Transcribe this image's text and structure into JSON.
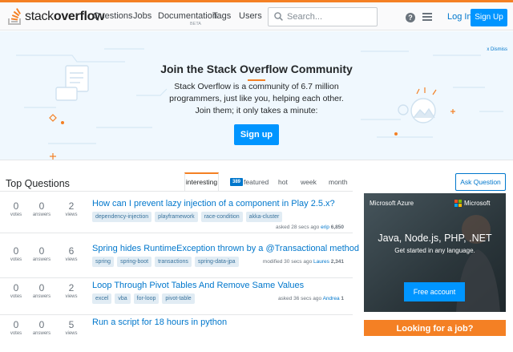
{
  "brand": {
    "logo_light": "stack",
    "logo_bold": "overflow",
    "accent": "#f48024",
    "link": "#0077cc",
    "primary": "#0095ff"
  },
  "nav": {
    "questions": "Questions",
    "jobs": "Jobs",
    "documentation": "Documentation",
    "documentation_badge": "BETA",
    "tags": "Tags",
    "users": "Users"
  },
  "search": {
    "placeholder": "Search..."
  },
  "header": {
    "help_icon": "help-icon",
    "menu_icon": "hamburger-menu-icon",
    "login": "Log In",
    "signup": "Sign Up"
  },
  "hero": {
    "dismiss": "x Dismiss",
    "title": "Join the Stack Overflow Community",
    "line1": "Stack Overflow is a community of 6.7 million",
    "line2": "programmers, just like you, helping each other.",
    "line3": "Join them; it only takes a minute:",
    "button": "Sign up"
  },
  "questions_section": {
    "title": "Top Questions",
    "tabs": [
      {
        "label": "interesting",
        "active": true
      },
      {
        "label": "featured",
        "badge": "389"
      },
      {
        "label": "hot"
      },
      {
        "label": "week"
      },
      {
        "label": "month"
      }
    ],
    "ask_button": "Ask Question",
    "items": [
      {
        "votes": "0",
        "votes_label": "votes",
        "answers": "0",
        "answers_label": "answers",
        "views": "2",
        "views_label": "views",
        "title": "How can I prevent lazy injection of a component in Play 2.5.x?",
        "tags": [
          "dependency-injection",
          "playframework",
          "race-condition",
          "akka-cluster"
        ],
        "meta_action": "asked 28 secs ago",
        "meta_user": "erip",
        "meta_rep": "6,850"
      },
      {
        "votes": "0",
        "votes_label": "votes",
        "answers": "0",
        "answers_label": "answers",
        "views": "6",
        "views_label": "views",
        "title": "Spring hides RuntimeException thrown by a @Transactional method",
        "tags": [
          "spring",
          "spring-boot",
          "transactions",
          "spring-data-jpa"
        ],
        "meta_action": "modified 30 secs ago",
        "meta_user": "Laures",
        "meta_rep": "2,341"
      },
      {
        "votes": "0",
        "votes_label": "votes",
        "answers": "0",
        "answers_label": "answers",
        "views": "2",
        "views_label": "views",
        "title": "Loop Through Pivot Tables And Remove Same Values",
        "tags": [
          "excel",
          "vba",
          "for-loop",
          "pivot-table"
        ],
        "meta_action": "asked 36 secs ago",
        "meta_user": "Andrea",
        "meta_rep": "1"
      },
      {
        "votes": "0",
        "votes_label": "votes",
        "answers": "0",
        "answers_label": "answers",
        "views": "5",
        "views_label": "views",
        "title": "Run a script for 18 hours in python",
        "tags": [],
        "meta_action": "",
        "meta_user": "",
        "meta_rep": ""
      }
    ]
  },
  "ad": {
    "brand": "Microsoft Azure",
    "company": "Microsoft",
    "headline": "Java, Node.js, PHP, .NET",
    "subline": "Get started in any language.",
    "button": "Free account"
  },
  "jobs_banner": {
    "text": "Looking for a job?"
  }
}
